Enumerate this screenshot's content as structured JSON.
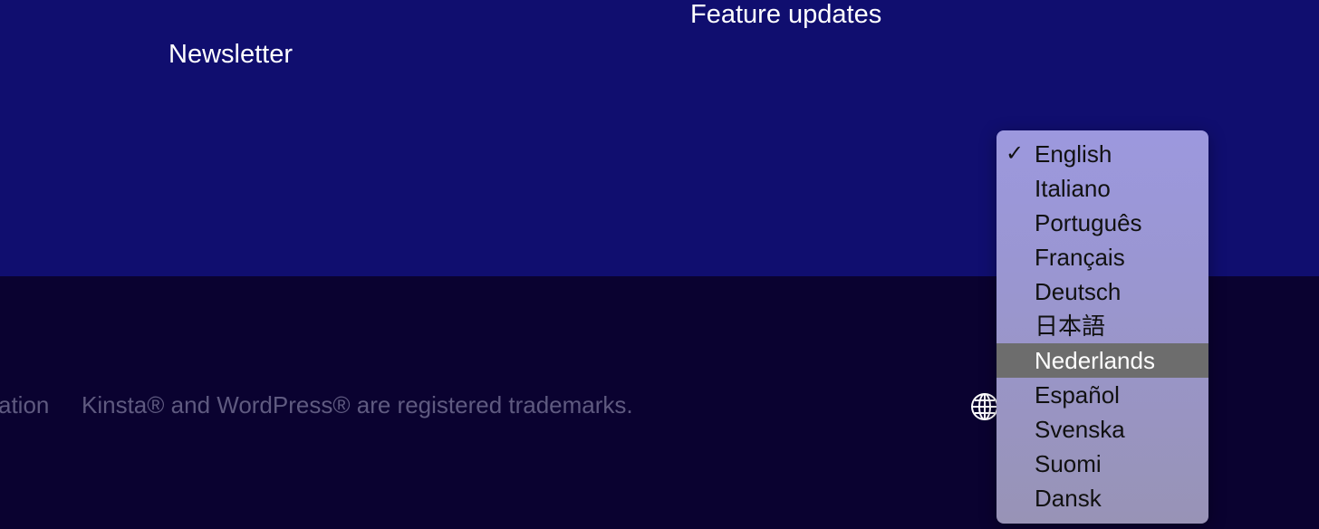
{
  "nav": {
    "newsletter": "Newsletter",
    "feature_updates": "Feature updates"
  },
  "footer": {
    "partial_link": "ation",
    "trademark": "Kinsta® and WordPress® are registered trademarks."
  },
  "language_menu": {
    "icon": "globe-icon",
    "selected": "English",
    "highlighted": "Nederlands",
    "items": [
      "English",
      "Italiano",
      "Português",
      "Français",
      "Deutsch",
      "日本語",
      "Nederlands",
      "Español",
      "Svenska",
      "Suomi",
      "Dansk"
    ]
  },
  "colors": {
    "top_bg": "#100e6f",
    "bottom_bg": "#0a0230",
    "highlight": "#6d6d6d"
  }
}
